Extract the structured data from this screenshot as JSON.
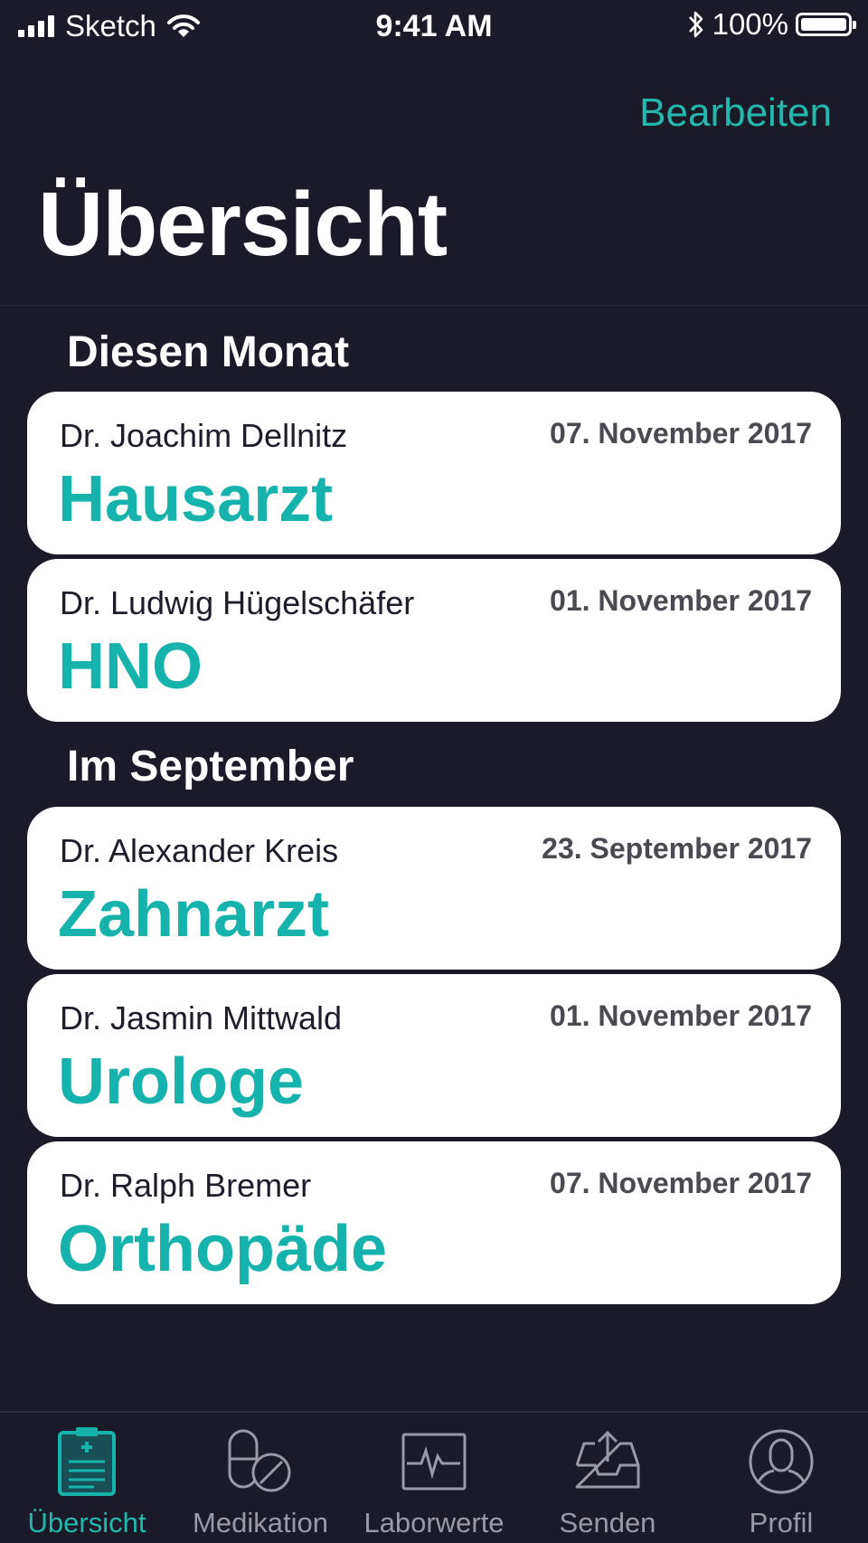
{
  "status_bar": {
    "carrier": "Sketch",
    "time": "9:41 AM",
    "battery_text": "100%",
    "battery_level": 1.0
  },
  "nav": {
    "edit_label": "Bearbeiten",
    "title": "Übersicht"
  },
  "sections": [
    {
      "heading": "Diesen Monat",
      "cards": [
        {
          "doctor": "Dr. Joachim Dellnitz",
          "date": "07. November 2017",
          "specialty": "Hausarzt"
        },
        {
          "doctor": "Dr. Ludwig Hügelschäfer",
          "date": "01. November 2017",
          "specialty": "HNO"
        }
      ]
    },
    {
      "heading": "Im September",
      "cards": [
        {
          "doctor": "Dr. Alexander Kreis",
          "date": "23. September 2017",
          "specialty": "Zahnarzt"
        },
        {
          "doctor": "Dr. Jasmin Mittwald",
          "date": "01. November 2017",
          "specialty": "Urologe"
        },
        {
          "doctor": "Dr. Ralph Bremer",
          "date": "07. November 2017",
          "specialty": "Orthopäde"
        }
      ]
    }
  ],
  "tabbar": {
    "active": "Übersicht",
    "tabs": [
      {
        "label": "Übersicht",
        "icon": "clipboard-icon"
      },
      {
        "label": "Medikation",
        "icon": "pills-icon"
      },
      {
        "label": "Laborwerte",
        "icon": "heartbeat-icon"
      },
      {
        "label": "Senden",
        "icon": "inbox-upload-icon"
      },
      {
        "label": "Profil",
        "icon": "profile-icon"
      }
    ]
  },
  "colors": {
    "background": "#1a1a28",
    "accent": "#16b3ad",
    "card": "#ffffff",
    "inactive_tab": "#9a9aa6"
  }
}
